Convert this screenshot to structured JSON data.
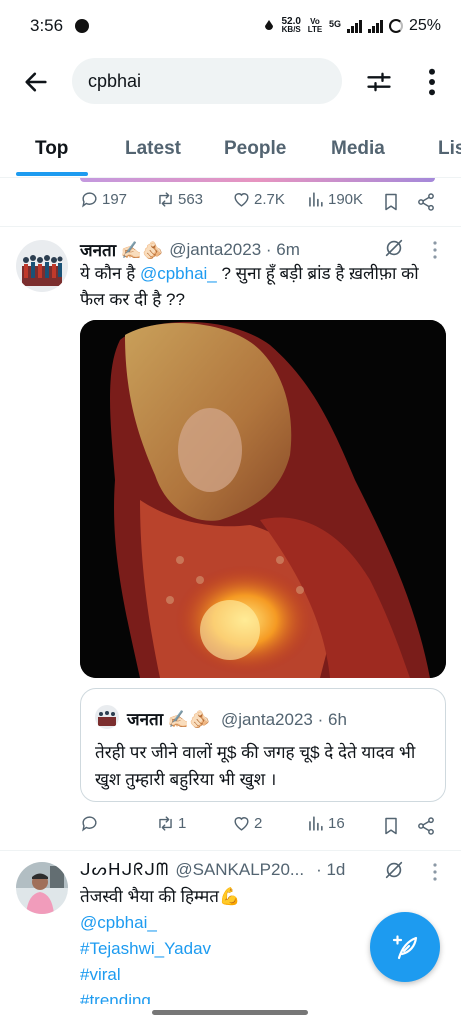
{
  "status_bar": {
    "time": "3:56",
    "net_speed_value": "52.0",
    "net_speed_unit": "KB/S",
    "volte": "Vo LTE",
    "network": "5G",
    "battery": "25%"
  },
  "search": {
    "query": "cpbhai"
  },
  "tabs": [
    "Top",
    "Latest",
    "People",
    "Media",
    "Lis"
  ],
  "prev_tweet_actions": {
    "replies": "197",
    "reposts": "563",
    "likes": "2.7K",
    "views": "190K"
  },
  "tweet1": {
    "display_name": "जनता ✍🏻🫵🏻",
    "handle": "@janta2023 · 6m",
    "text_part1": "ये कौन है ",
    "mention": "@cpbhai_",
    "text_part2": " ? सुना हूँ बड़ी ब्रांड है ख़लीफ़ा को फैल कर दी है ??",
    "quote": {
      "display_name": "जनता ✍🏻🫵🏻",
      "handle": "@janta2023 · 6h",
      "text": "तेरही पर जीने वालों मू$ की जगह चू$ दे देते यादव भी खुश तुम्हारी बहुरिया भी खुश ।"
    },
    "actions": {
      "replies": "",
      "reposts": "1",
      "likes": "2",
      "views": "16"
    }
  },
  "tweet2": {
    "display_name": "ᒍᔕᕼᒍᖇᒍᗰ",
    "handle": "@SANKALP20...",
    "time": "· 1d",
    "line1": "तेजस्वी भैया की हिम्मत💪",
    "mention": "@cpbhai_",
    "tags": [
      "#Tejashwi_Yadav",
      "#viral",
      "#trending"
    ]
  },
  "colors": {
    "accent": "#1d9bf0",
    "text": "#0f1419",
    "secondary": "#536471"
  }
}
